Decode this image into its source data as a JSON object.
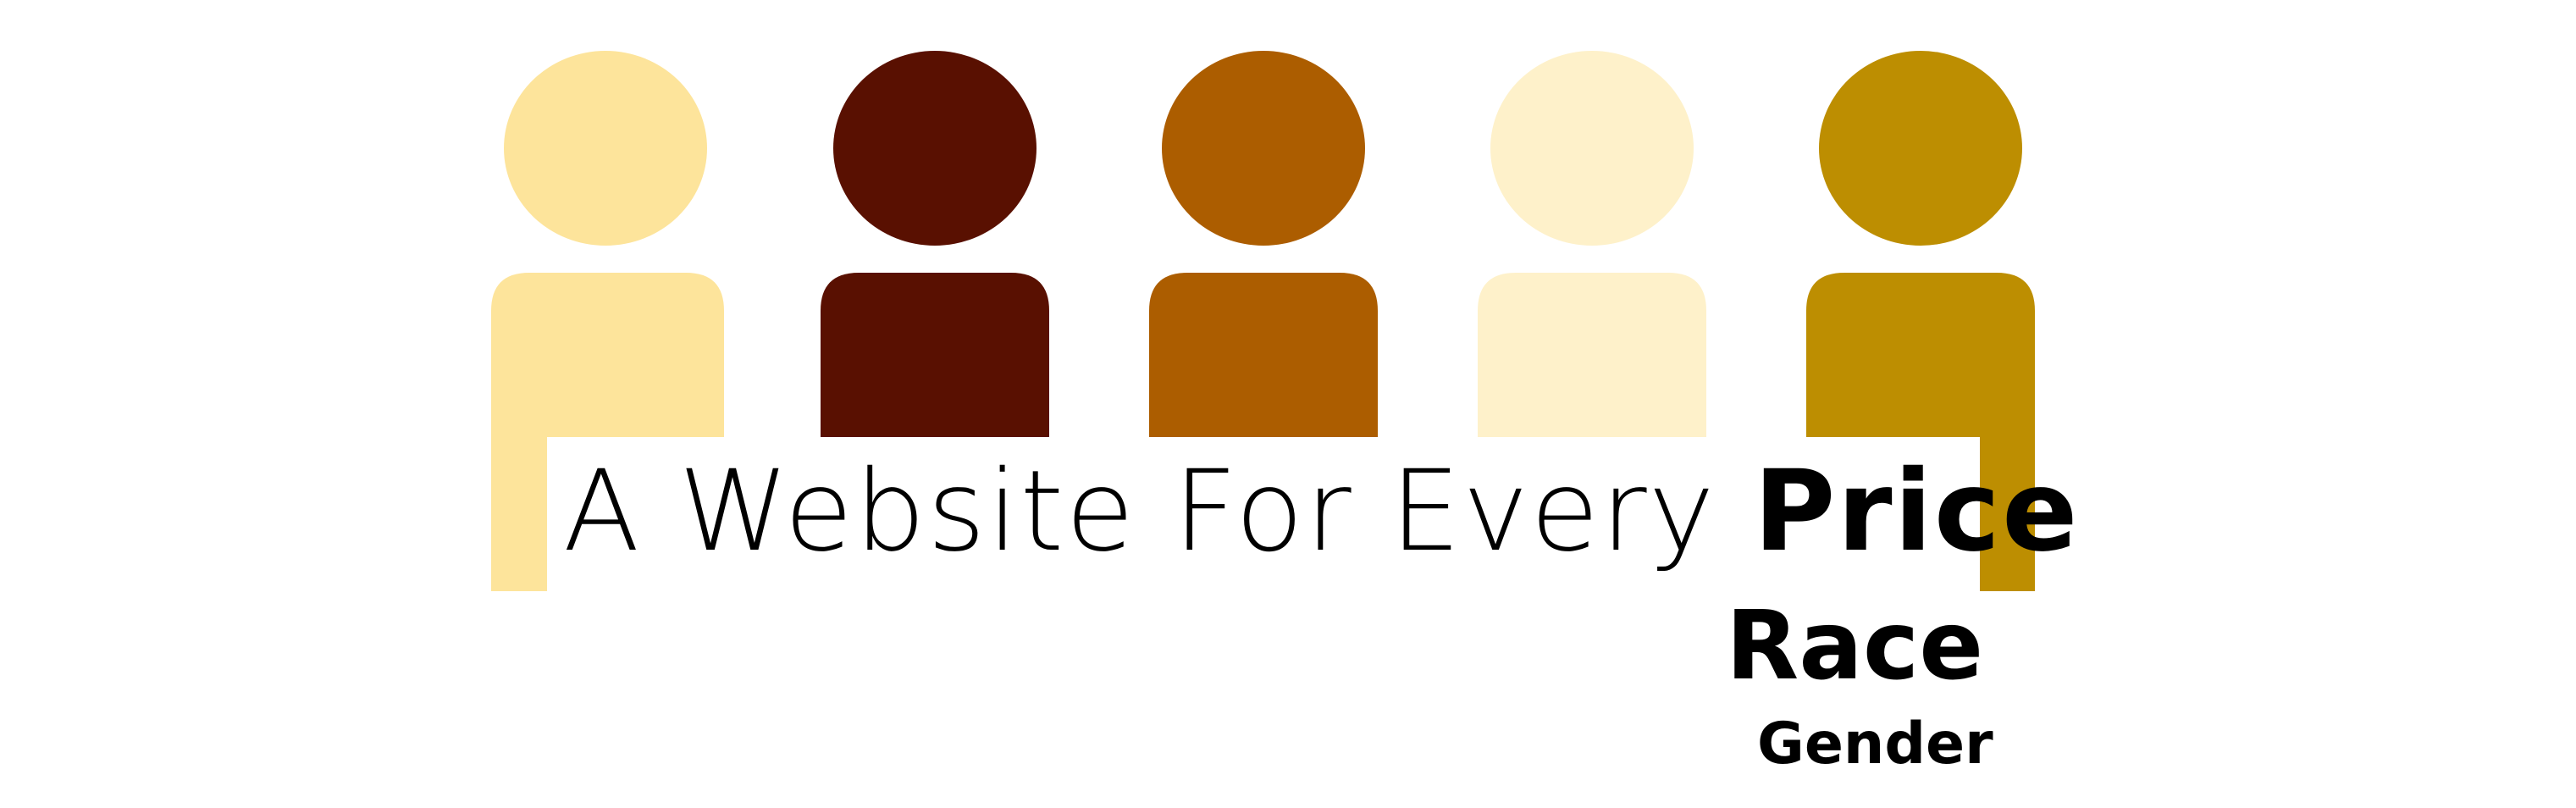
{
  "logo": {
    "tagline_lead": "A Website For Every",
    "tagline_emphasis": "Price",
    "second_word": "Race",
    "third_word": "Gender"
  },
  "figures": [
    {
      "name": "person-figure-1",
      "color": "#FDE49B"
    },
    {
      "name": "person-figure-2",
      "color": "#591001"
    },
    {
      "name": "person-figure-3",
      "color": "#AC5D00"
    },
    {
      "name": "person-figure-4",
      "color": "#FEF1CA"
    },
    {
      "name": "person-figure-5",
      "color": "#BD8E01"
    }
  ]
}
